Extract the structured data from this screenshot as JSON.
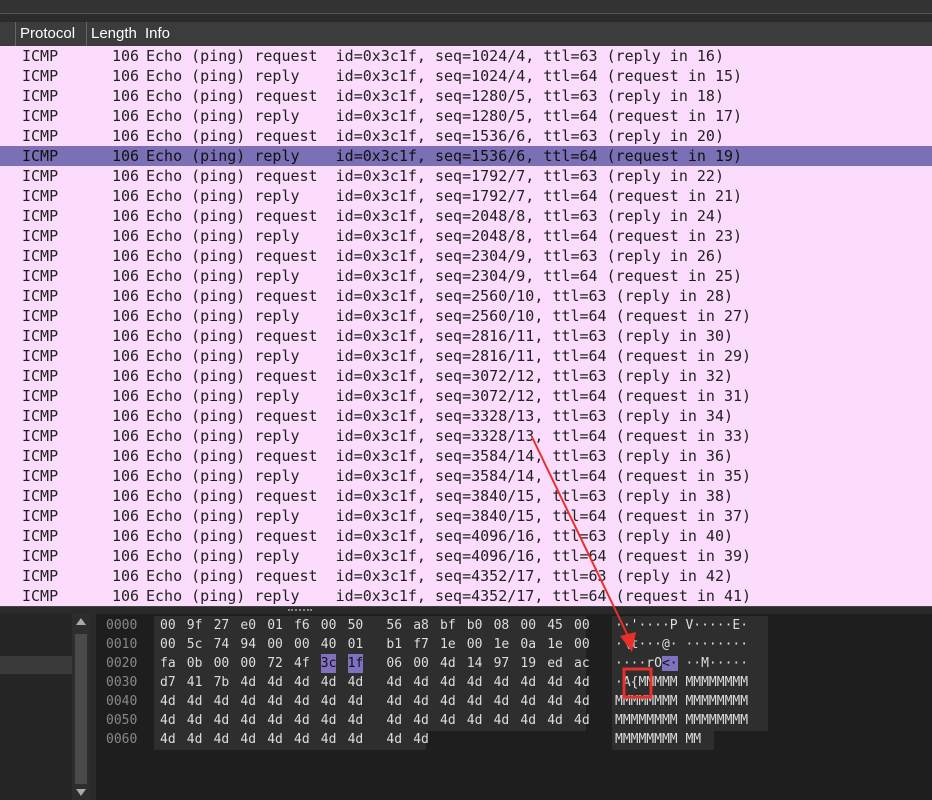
{
  "header": {
    "protocol": "Protocol",
    "length": "Length",
    "info": "Info"
  },
  "packets": [
    {
      "protocol": "ICMP",
      "length": "106",
      "info": "Echo (ping) request  id=0x3c1f, seq=1024/4, ttl=63 (reply in 16)",
      "selected": false
    },
    {
      "protocol": "ICMP",
      "length": "106",
      "info": "Echo (ping) reply    id=0x3c1f, seq=1024/4, ttl=64 (request in 15)",
      "selected": false
    },
    {
      "protocol": "ICMP",
      "length": "106",
      "info": "Echo (ping) request  id=0x3c1f, seq=1280/5, ttl=63 (reply in 18)",
      "selected": false
    },
    {
      "protocol": "ICMP",
      "length": "106",
      "info": "Echo (ping) reply    id=0x3c1f, seq=1280/5, ttl=64 (request in 17)",
      "selected": false
    },
    {
      "protocol": "ICMP",
      "length": "106",
      "info": "Echo (ping) request  id=0x3c1f, seq=1536/6, ttl=63 (reply in 20)",
      "selected": false
    },
    {
      "protocol": "ICMP",
      "length": "106",
      "info": "Echo (ping) reply    id=0x3c1f, seq=1536/6, ttl=64 (request in 19)",
      "selected": true
    },
    {
      "protocol": "ICMP",
      "length": "106",
      "info": "Echo (ping) request  id=0x3c1f, seq=1792/7, ttl=63 (reply in 22)",
      "selected": false
    },
    {
      "protocol": "ICMP",
      "length": "106",
      "info": "Echo (ping) reply    id=0x3c1f, seq=1792/7, ttl=64 (request in 21)",
      "selected": false
    },
    {
      "protocol": "ICMP",
      "length": "106",
      "info": "Echo (ping) request  id=0x3c1f, seq=2048/8, ttl=63 (reply in 24)",
      "selected": false
    },
    {
      "protocol": "ICMP",
      "length": "106",
      "info": "Echo (ping) reply    id=0x3c1f, seq=2048/8, ttl=64 (request in 23)",
      "selected": false
    },
    {
      "protocol": "ICMP",
      "length": "106",
      "info": "Echo (ping) request  id=0x3c1f, seq=2304/9, ttl=63 (reply in 26)",
      "selected": false
    },
    {
      "protocol": "ICMP",
      "length": "106",
      "info": "Echo (ping) reply    id=0x3c1f, seq=2304/9, ttl=64 (request in 25)",
      "selected": false
    },
    {
      "protocol": "ICMP",
      "length": "106",
      "info": "Echo (ping) request  id=0x3c1f, seq=2560/10, ttl=63 (reply in 28)",
      "selected": false
    },
    {
      "protocol": "ICMP",
      "length": "106",
      "info": "Echo (ping) reply    id=0x3c1f, seq=2560/10, ttl=64 (request in 27)",
      "selected": false
    },
    {
      "protocol": "ICMP",
      "length": "106",
      "info": "Echo (ping) request  id=0x3c1f, seq=2816/11, ttl=63 (reply in 30)",
      "selected": false
    },
    {
      "protocol": "ICMP",
      "length": "106",
      "info": "Echo (ping) reply    id=0x3c1f, seq=2816/11, ttl=64 (request in 29)",
      "selected": false
    },
    {
      "protocol": "ICMP",
      "length": "106",
      "info": "Echo (ping) request  id=0x3c1f, seq=3072/12, ttl=63 (reply in 32)",
      "selected": false
    },
    {
      "protocol": "ICMP",
      "length": "106",
      "info": "Echo (ping) reply    id=0x3c1f, seq=3072/12, ttl=64 (request in 31)",
      "selected": false
    },
    {
      "protocol": "ICMP",
      "length": "106",
      "info": "Echo (ping) request  id=0x3c1f, seq=3328/13, ttl=63 (reply in 34)",
      "selected": false
    },
    {
      "protocol": "ICMP",
      "length": "106",
      "info": "Echo (ping) reply    id=0x3c1f, seq=3328/13, ttl=64 (request in 33)",
      "selected": false
    },
    {
      "protocol": "ICMP",
      "length": "106",
      "info": "Echo (ping) request  id=0x3c1f, seq=3584/14, ttl=63 (reply in 36)",
      "selected": false
    },
    {
      "protocol": "ICMP",
      "length": "106",
      "info": "Echo (ping) reply    id=0x3c1f, seq=3584/14, ttl=64 (request in 35)",
      "selected": false
    },
    {
      "protocol": "ICMP",
      "length": "106",
      "info": "Echo (ping) request  id=0x3c1f, seq=3840/15, ttl=63 (reply in 38)",
      "selected": false
    },
    {
      "protocol": "ICMP",
      "length": "106",
      "info": "Echo (ping) reply    id=0x3c1f, seq=3840/15, ttl=64 (request in 37)",
      "selected": false
    },
    {
      "protocol": "ICMP",
      "length": "106",
      "info": "Echo (ping) request  id=0x3c1f, seq=4096/16, ttl=63 (reply in 40)",
      "selected": false
    },
    {
      "protocol": "ICMP",
      "length": "106",
      "info": "Echo (ping) reply    id=0x3c1f, seq=4096/16, ttl=64 (request in 39)",
      "selected": false
    },
    {
      "protocol": "ICMP",
      "length": "106",
      "info": "Echo (ping) request  id=0x3c1f, seq=4352/17, ttl=63 (reply in 42)",
      "selected": false
    },
    {
      "protocol": "ICMP",
      "length": "106",
      "info": "Echo (ping) reply    id=0x3c1f, seq=4352/17, ttl=64 (request in 41)",
      "selected": false
    }
  ],
  "hexdump": [
    {
      "offset": "0000",
      "bytes": [
        "00",
        "9f",
        "27",
        "e0",
        "01",
        "f6",
        "00",
        "50",
        "56",
        "a8",
        "bf",
        "b0",
        "08",
        "00",
        "45",
        "00"
      ],
      "ascii": "··'····P V·····E·"
    },
    {
      "offset": "0010",
      "bytes": [
        "00",
        "5c",
        "74",
        "94",
        "00",
        "00",
        "40",
        "01",
        "b1",
        "f7",
        "1e",
        "00",
        "1e",
        "0a",
        "1e",
        "00"
      ],
      "ascii": "·\\t···@· ········"
    },
    {
      "offset": "0020",
      "bytes": [
        "fa",
        "0b",
        "00",
        "00",
        "72",
        "4f",
        "3c",
        "1f",
        "06",
        "00",
        "4d",
        "14",
        "97",
        "19",
        "ed",
        "ac"
      ],
      "ascii": "····rO<· ··M·····"
    },
    {
      "offset": "0030",
      "bytes": [
        "d7",
        "41",
        "7b",
        "4d",
        "4d",
        "4d",
        "4d",
        "4d",
        "4d",
        "4d",
        "4d",
        "4d",
        "4d",
        "4d",
        "4d",
        "4d"
      ],
      "ascii": "·A{MMMMM MMMMMMMM"
    },
    {
      "offset": "0040",
      "bytes": [
        "4d",
        "4d",
        "4d",
        "4d",
        "4d",
        "4d",
        "4d",
        "4d",
        "4d",
        "4d",
        "4d",
        "4d",
        "4d",
        "4d",
        "4d",
        "4d"
      ],
      "ascii": "MMMMMMMM MMMMMMMM"
    },
    {
      "offset": "0050",
      "bytes": [
        "4d",
        "4d",
        "4d",
        "4d",
        "4d",
        "4d",
        "4d",
        "4d",
        "4d",
        "4d",
        "4d",
        "4d",
        "4d",
        "4d",
        "4d",
        "4d"
      ],
      "ascii": "MMMMMMMM MMMMMMMM"
    },
    {
      "offset": "0060",
      "bytes": [
        "4d",
        "4d",
        "4d",
        "4d",
        "4d",
        "4d",
        "4d",
        "4d",
        "4d",
        "4d"
      ],
      "ascii": "MMMMMMMM MM"
    }
  ],
  "colors": {
    "packet_bg": "#fcdcfc",
    "selected_row": "#7b6fb5",
    "byte_highlight": "#8070c0",
    "annotation": "#e8302a"
  }
}
